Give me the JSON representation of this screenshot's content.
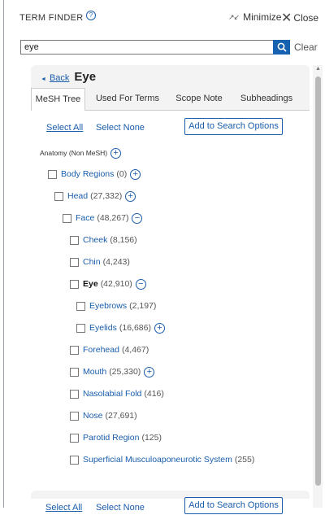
{
  "header": {
    "title": "TERM FINDER",
    "help_icon": "?",
    "minimize_label": "Minimize",
    "minimize_icon": "↗↙",
    "close_label": "Close",
    "close_icon": "✕"
  },
  "search": {
    "value": "eye",
    "button_icon": "🔍",
    "clear_label": "Clear"
  },
  "breadcrumb": {
    "back_label": "Back",
    "term": "Eye"
  },
  "tabs": [
    {
      "label": "MeSH Tree",
      "active": true
    },
    {
      "label": "Used For Terms"
    },
    {
      "label": "Scope Note"
    },
    {
      "label": "Subheadings"
    }
  ],
  "actions": {
    "select_all": "Select All",
    "select_none": "Select None",
    "add_button": "Add to Search Options"
  },
  "tree": {
    "root": "Anatomy (Non MeSH)",
    "nodes": [
      {
        "label": "Body Regions",
        "count": "(0)",
        "toggle": "+"
      },
      {
        "label": "Head",
        "count": "(27,332)",
        "toggle": "+"
      },
      {
        "label": "Face",
        "count": "(48,267)",
        "toggle": "−"
      },
      {
        "label": "Cheek",
        "count": "(8,156)"
      },
      {
        "label": "Chin",
        "count": "(4,243)"
      },
      {
        "label": "Eye",
        "count": "(42,910)",
        "toggle": "−"
      },
      {
        "label": "Eyebrows",
        "count": "(2,197)"
      },
      {
        "label": "Eyelids",
        "count": "(16,686)",
        "toggle": "+"
      },
      {
        "label": "Forehead",
        "count": "(4,467)"
      },
      {
        "label": "Mouth",
        "count": "(25,330)",
        "toggle": "+"
      },
      {
        "label": "Nasolabial Fold",
        "count": "(416)"
      },
      {
        "label": "Nose",
        "count": "(27,691)"
      },
      {
        "label": "Parotid Region",
        "count": "(125)"
      },
      {
        "label": "Superficial Musculoaponeurotic System",
        "count": "(255)"
      }
    ]
  },
  "footer_panel": {
    "select_all": "Select All",
    "select_none": "Select None",
    "add_button": "Add to Search Options"
  },
  "scrollbar": {
    "up_icon": "▲"
  }
}
